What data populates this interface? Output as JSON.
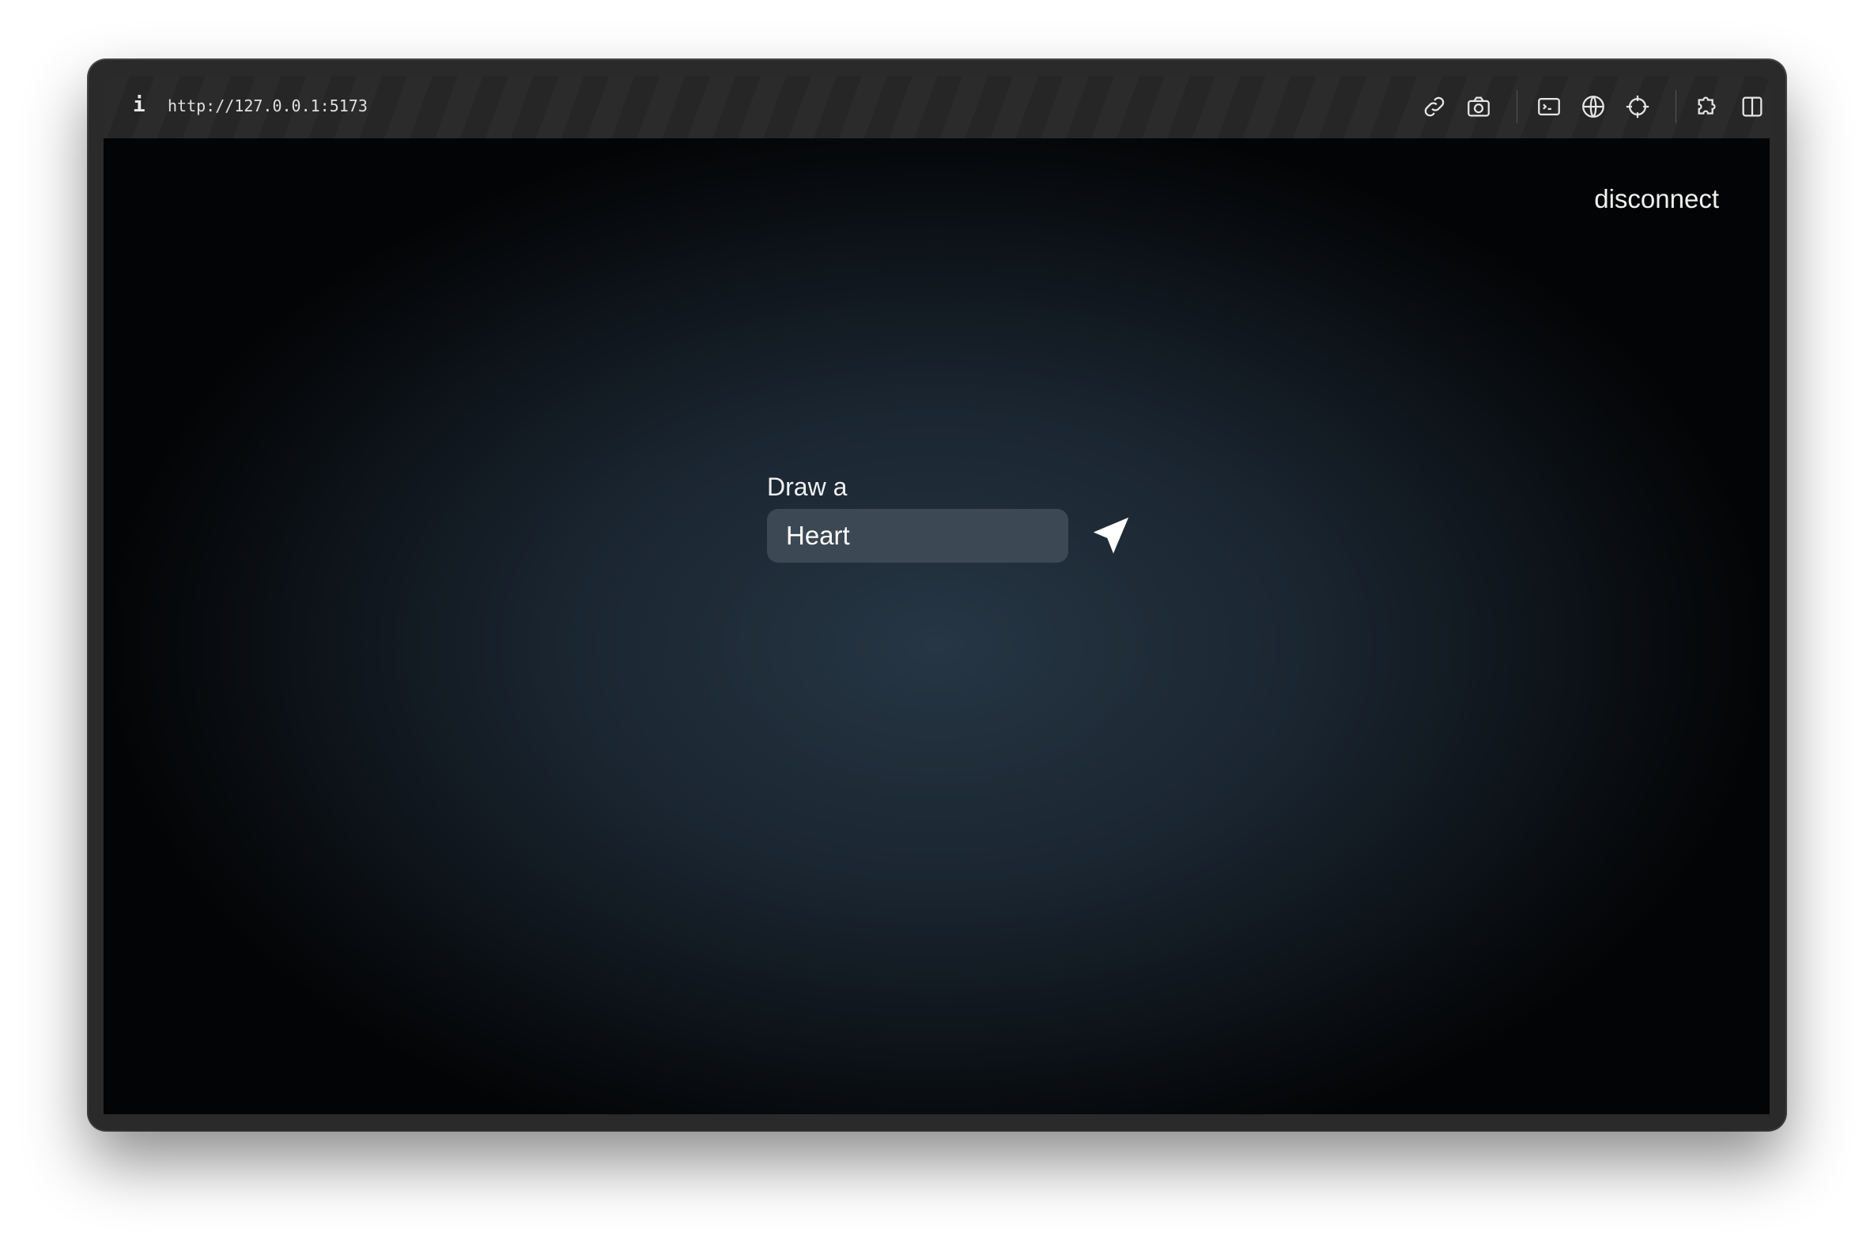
{
  "toolbar": {
    "info_label": "i",
    "url": "http://127.0.0.1:5173",
    "icons": [
      "link-icon",
      "camera-icon",
      "terminal-icon",
      "globe-icon",
      "crosshair-icon",
      "puzzle-icon",
      "sidebar-icon"
    ]
  },
  "page": {
    "disconnect_label": "disconnect",
    "prompt_label": "Draw a",
    "input_value": "Heart",
    "send_icon": "paper-plane-icon"
  }
}
